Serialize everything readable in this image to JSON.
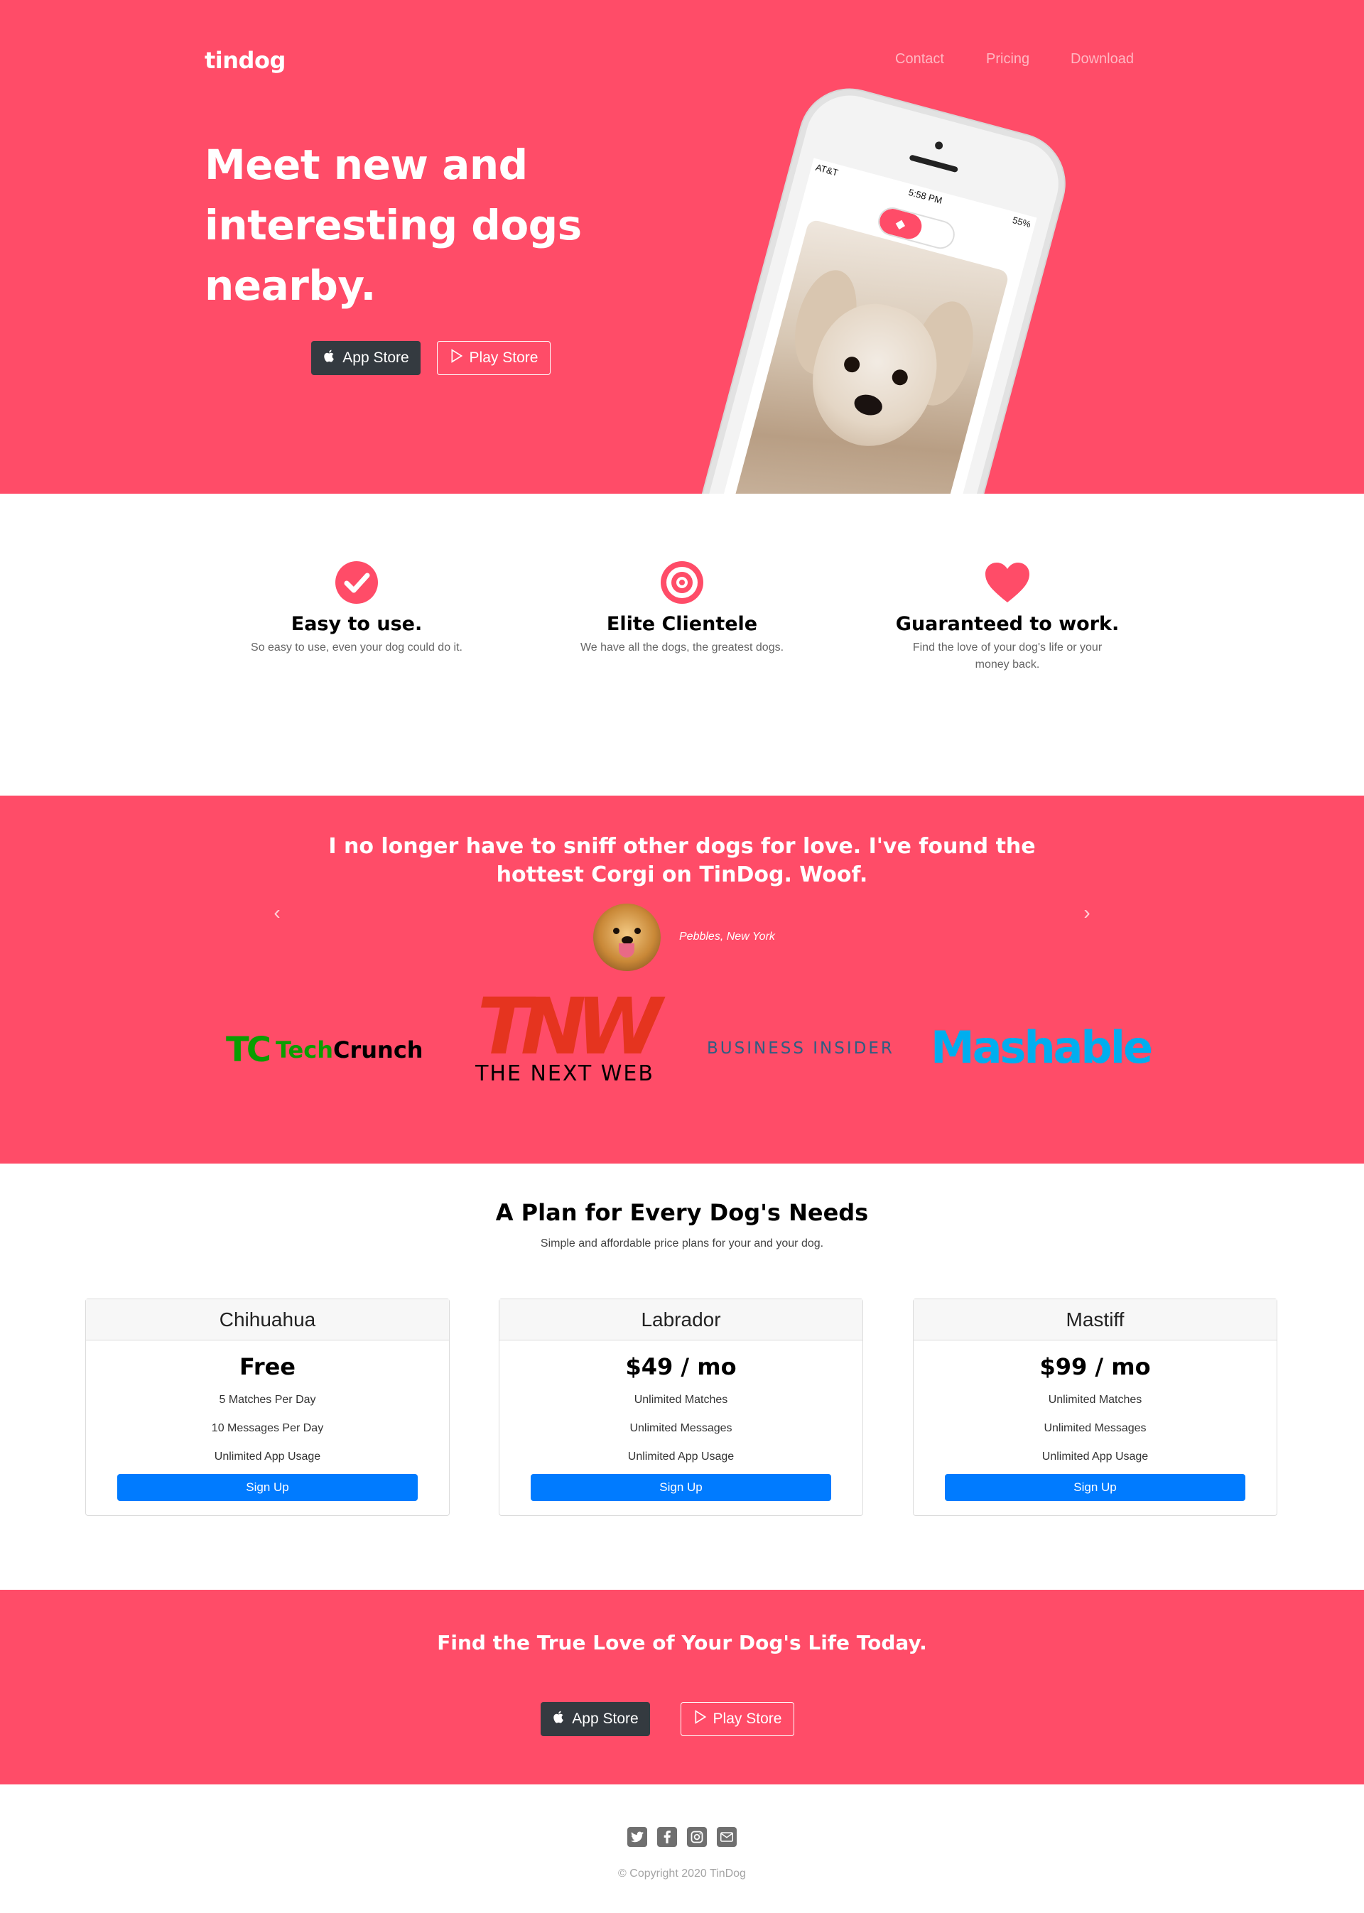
{
  "header": {
    "brand": "tindog",
    "nav": [
      "Contact",
      "Pricing",
      "Download"
    ]
  },
  "hero": {
    "title": "Meet new and interesting dogs nearby.",
    "app_store_label": "App Store",
    "play_store_label": "Play Store",
    "phone": {
      "carrier": "AT&T",
      "time": "5:58 PM",
      "battery": "55%"
    }
  },
  "features": [
    {
      "icon": "check-circle-icon",
      "title": "Easy to use.",
      "text": "So easy to use, even your dog could do it."
    },
    {
      "icon": "target-icon",
      "title": "Elite Clientele",
      "text": "We have all the dogs, the greatest dogs."
    },
    {
      "icon": "heart-icon",
      "title": "Guaranteed to work.",
      "text": "Find the love of your dog's life or your money back."
    }
  ],
  "testimonial": {
    "quote": "I no longer have to sniff other dogs for love. I've found the hottest Corgi on TinDog. Woof.",
    "caption": "Pebbles, New York"
  },
  "press": {
    "techcrunch_text_a": "Tech",
    "techcrunch_text_b": "Crunch",
    "techcrunch_mark": "TC",
    "tnw_mark": "TNW",
    "tnw_sub": "THE NEXT WEB",
    "business_insider": "BUSINESS INSIDER",
    "mashable": "Mashable"
  },
  "pricing": {
    "title": "A Plan for Every Dog's Needs",
    "subtitle": "Simple and affordable price plans for your and your dog.",
    "plans": [
      {
        "name": "Chihuahua",
        "price": "Free",
        "features": [
          "5 Matches Per Day",
          "10 Messages Per Day",
          "Unlimited App Usage"
        ],
        "button": "Sign Up"
      },
      {
        "name": "Labrador",
        "price": "$49 / mo",
        "features": [
          "Unlimited Matches",
          "Unlimited Messages",
          "Unlimited App Usage"
        ],
        "button": "Sign Up"
      },
      {
        "name": "Mastiff",
        "price": "$99 / mo",
        "features": [
          "Unlimited Matches",
          "Unlimited Messages",
          "Unlimited App Usage"
        ],
        "button": "Sign Up"
      }
    ]
  },
  "cta": {
    "title": "Find the True Love of Your Dog's Life Today.",
    "app_store_label": "App Store",
    "play_store_label": "Play Store"
  },
  "footer": {
    "socials": [
      "twitter-icon",
      "facebook-icon",
      "instagram-icon",
      "envelope-icon"
    ],
    "copyright": "© Copyright 2020 TinDog"
  },
  "colors": {
    "brand_pink": "#ff4c68",
    "button_dark": "#343a40",
    "primary_blue": "#007bff"
  }
}
